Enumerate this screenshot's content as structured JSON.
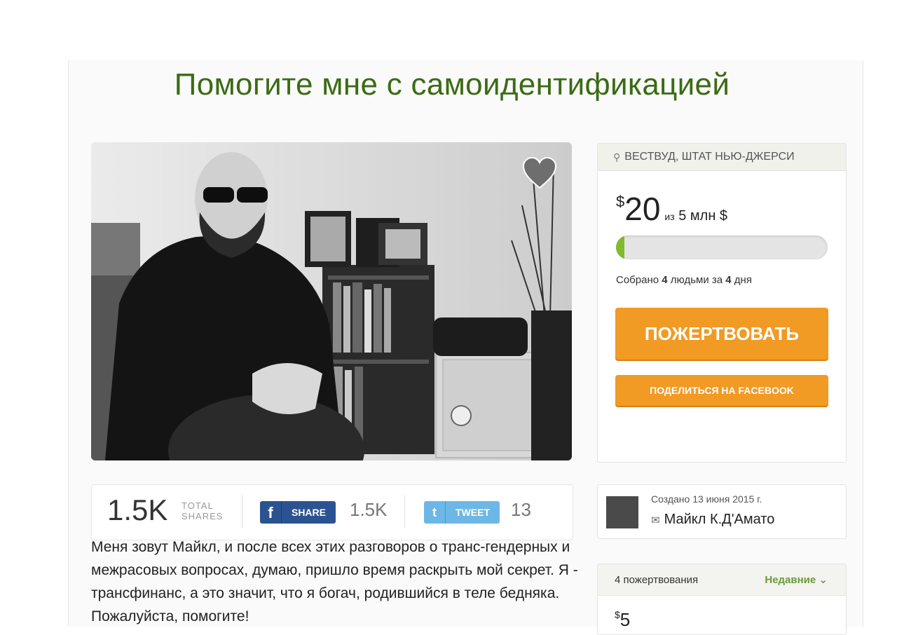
{
  "header": {
    "title": "Помогите мне с самоидентификацией"
  },
  "campaign": {
    "location": "ВЕСТВУД, ШТАТ НЬЮ-ДЖЕРСИ",
    "raised_currency": "$",
    "raised_amount": "20",
    "goal_prefix": "из",
    "goal_text": "5 млн $",
    "progress_fraction": 0.004,
    "collected_prefix": "Собрано",
    "collected_people": "4",
    "collected_middle": "людьми за",
    "collected_days": "4",
    "collected_suffix": "дня",
    "donate_label": "ПОЖЕРТВОВАТЬ",
    "share_facebook_label": "ПОДЕЛИТЬСЯ НА FACEBOOK"
  },
  "share_bar": {
    "total": "1.5K",
    "total_label_line1": "TOTAL",
    "total_label_line2": "SHARES",
    "fb_icon": "f",
    "fb_label": "SHARE",
    "fb_count": "1.5K",
    "tw_icon": "t",
    "tw_label": "TWEET",
    "tw_count": "13"
  },
  "description": "Меня зовут Майкл, и после всех этих разговоров о транс-гендерных и межрасовых вопросах, думаю, пришло время раскрыть мой секрет. Я - трансфинанс, а это значит, что я богач, родившийся в теле бедняка. Пожалуйста, помогите!",
  "organizer": {
    "created": "Создано 13 июня 2015 г.",
    "name": "Майкл К.Д'Амато"
  },
  "donations": {
    "count_label": "4 пожертвования",
    "sort_label": "Недавние",
    "first_currency": "$",
    "first_amount": "5"
  },
  "colors": {
    "title_green": "#3b6b14",
    "accent_orange": "#f19a24",
    "progress_green": "#7fbb2c",
    "facebook_blue": "#2c5391",
    "twitter_blue": "#6db7e6"
  }
}
